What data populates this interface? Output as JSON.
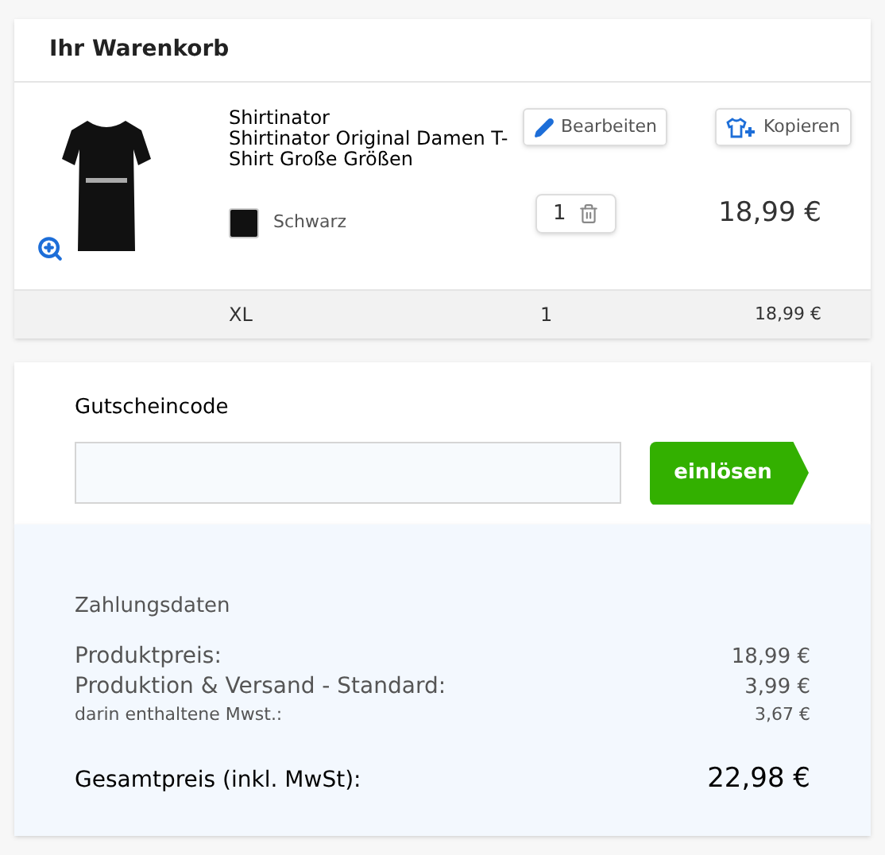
{
  "cart": {
    "title": "Ihr Warenkorb",
    "item": {
      "brand": "Shirtinator",
      "name": "Shirtinator Original Damen T-Shirt Große Größen",
      "color_name": "Schwarz",
      "color": "#111111",
      "edit": "Bearbeiten",
      "copy": "Kopieren",
      "quantity": "1",
      "price": "18,99 €",
      "sizes": [
        {
          "size": "XL",
          "quantity": "1",
          "price": "18,99 €"
        }
      ]
    }
  },
  "coupon": {
    "label": "Gutscheincode",
    "button": "einlösen"
  },
  "payment": {
    "title": "Zahlungsdaten",
    "lines": [
      {
        "kind": "normal",
        "label": "Produktpreis:",
        "value": "18,99 €"
      },
      {
        "kind": "normal",
        "label": "Produktion & Versand - Standard:",
        "value": "3,99 €"
      },
      {
        "kind": "small",
        "label": "darin enthaltene Mwst.:",
        "value": "3,67 €"
      },
      {
        "kind": "total",
        "label": "Gesamtpreis (inkl. MwSt):",
        "value": "22,98 €"
      }
    ]
  }
}
